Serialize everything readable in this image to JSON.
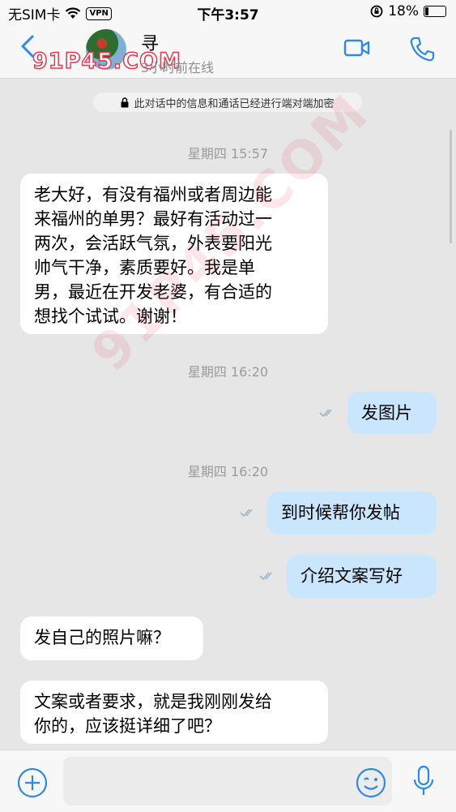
{
  "status": {
    "carrier": "无SIM卡",
    "vpn": "VPN",
    "time": "下午3:57",
    "battery": "18%",
    "battery_level": 0.18
  },
  "header": {
    "name": "寻",
    "subtitle": "3小时前在线",
    "avatar_watermark": "91P45.COM"
  },
  "notice": "此对话中的信息和通话已经进行端对端加密",
  "messages": [
    {
      "date": "星期四 15:57"
    },
    {
      "text": "老大好，有没有福州或者周边能来福州的单男？最好有活动过一两次，会活跃气氛，外表要阳光帅气干净，素质要好。我是单男，最近在开发老婆，有合适的想找个试试。谢谢！",
      "lines": [
        "老大好，有没有福州或者周边能",
        "来福州的单男？最好有活动过一",
        "两次，会活跃气氛，外表要阳光",
        "帅气干净，素质要好。我是单",
        "男，最近在开发老婆，有合适的",
        "想找个试试。谢谢！"
      ]
    },
    {
      "date": "星期四 16:20"
    },
    {
      "text": "发图片"
    },
    {
      "date": "星期四 16:20"
    },
    {
      "text": "到时候帮你发帖"
    },
    {
      "text": "介绍文案写好"
    },
    {
      "text": "发自己的照片嘛？"
    },
    {
      "lines": [
        "文案或者要求，就是我刚刚发给",
        "你的，应该挺详细了吧？"
      ]
    }
  ],
  "watermark_overlay": "91P45.COM",
  "composer": {
    "placeholder": ""
  },
  "colors": {
    "accent": "#2d89e5",
    "outgoing": "#c9e6fd",
    "incoming": "#ffffff",
    "background": "#e6e6e6"
  }
}
